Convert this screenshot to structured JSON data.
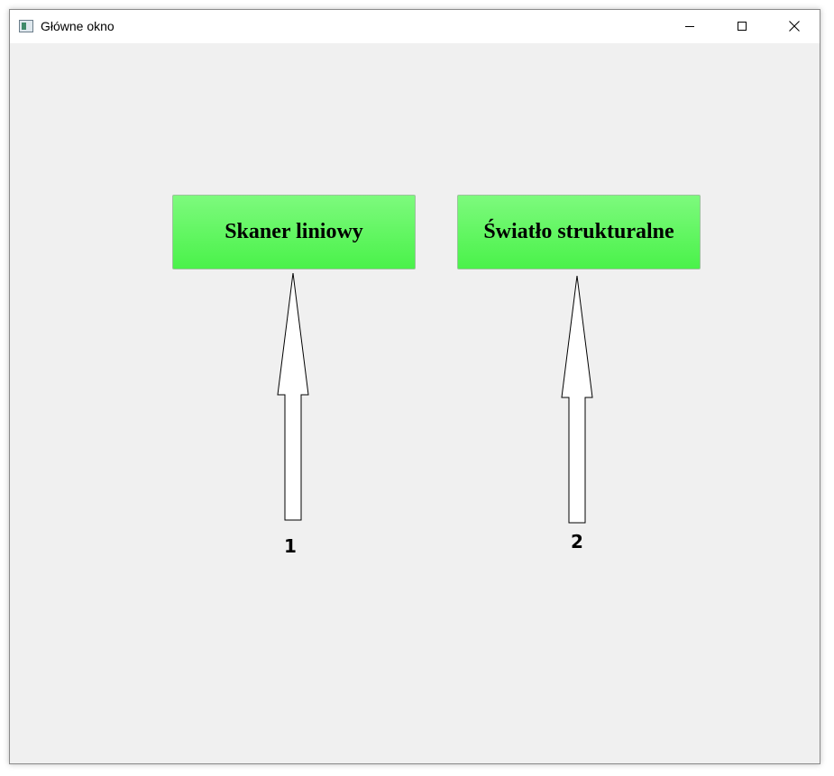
{
  "window": {
    "title": "Główne okno",
    "icon": "app-window-icon"
  },
  "controls": {
    "minimize_icon": "minimize-icon",
    "maximize_icon": "maximize-icon",
    "close_icon": "close-icon"
  },
  "buttons": [
    {
      "label": "Skaner liniowy",
      "color": "#4af24a"
    },
    {
      "label": "Światło strukturalne",
      "color": "#4af24a"
    }
  ],
  "annotations": {
    "arrow_1_label": "1",
    "arrow_2_label": "2",
    "arrow_icon": "up-arrow-icon"
  }
}
